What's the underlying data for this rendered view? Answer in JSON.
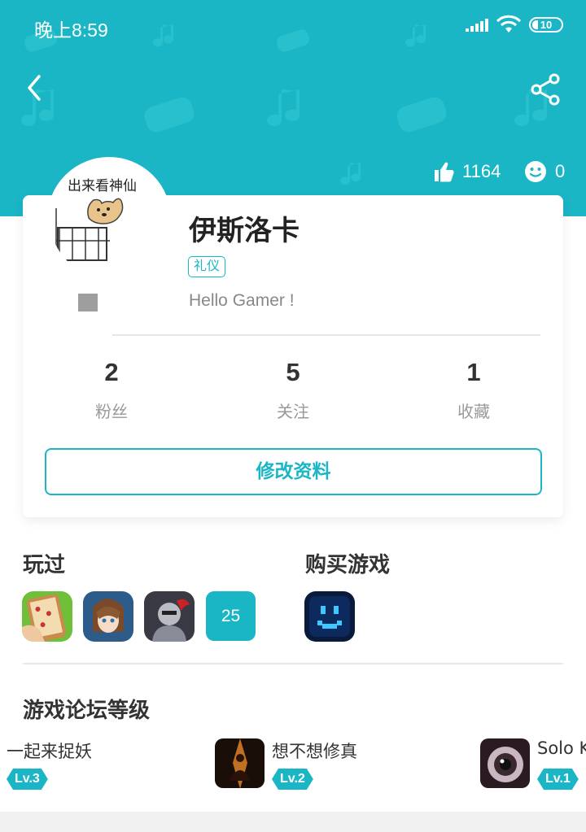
{
  "status_bar": {
    "time": "晚上8:59",
    "battery": "10"
  },
  "header": {
    "likes": "1164",
    "smiles": "0"
  },
  "profile": {
    "avatar_caption": "出来看神仙",
    "username": "伊斯洛卡",
    "tag": "礼仪",
    "bio": "Hello Gamer !",
    "stats": [
      {
        "value": "2",
        "label": "粉丝"
      },
      {
        "value": "5",
        "label": "关注"
      },
      {
        "value": "1",
        "label": "收藏"
      }
    ],
    "edit_button": "修改资料"
  },
  "played": {
    "title": "玩过",
    "more_count": "25"
  },
  "purchased": {
    "title": "购买游戏"
  },
  "forum": {
    "title": "游戏论坛等级",
    "items": [
      {
        "name": "一起来捉妖",
        "level": "Lv.3"
      },
      {
        "name": "想不想修真",
        "level": "Lv.2"
      },
      {
        "name": "Solo K",
        "level": "Lv.1"
      }
    ]
  },
  "colors": {
    "accent": "#1ab6c6",
    "text": "#333333",
    "muted": "#999999"
  }
}
